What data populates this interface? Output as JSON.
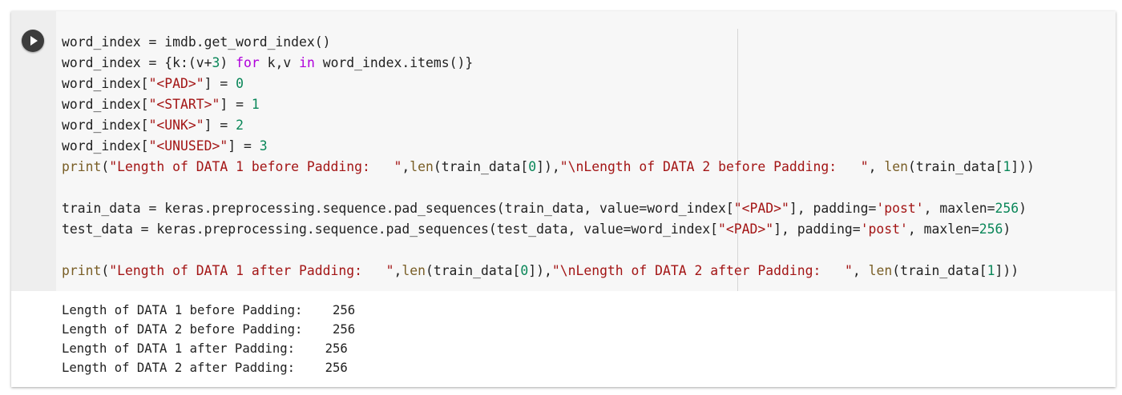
{
  "cell": {
    "run_button_icon": "play-icon",
    "code_lines": [
      [
        {
          "t": "word_index = imdb.get_word_index()",
          "c": "p"
        }
      ],
      [
        {
          "t": "word_index = {k:(v+",
          "c": "p"
        },
        {
          "t": "3",
          "c": "num"
        },
        {
          "t": ") ",
          "c": "p"
        },
        {
          "t": "for",
          "c": "kw"
        },
        {
          "t": " k,v ",
          "c": "p"
        },
        {
          "t": "in",
          "c": "kw"
        },
        {
          "t": " word_index.items()}",
          "c": "p"
        }
      ],
      [
        {
          "t": "word_index[",
          "c": "p"
        },
        {
          "t": "\"<PAD>\"",
          "c": "str"
        },
        {
          "t": "] = ",
          "c": "p"
        },
        {
          "t": "0",
          "c": "num"
        }
      ],
      [
        {
          "t": "word_index[",
          "c": "p"
        },
        {
          "t": "\"<START>\"",
          "c": "str"
        },
        {
          "t": "] = ",
          "c": "p"
        },
        {
          "t": "1",
          "c": "num"
        }
      ],
      [
        {
          "t": "word_index[",
          "c": "p"
        },
        {
          "t": "\"<UNK>\"",
          "c": "str"
        },
        {
          "t": "] = ",
          "c": "p"
        },
        {
          "t": "2",
          "c": "num"
        }
      ],
      [
        {
          "t": "word_index[",
          "c": "p"
        },
        {
          "t": "\"<UNUSED>\"",
          "c": "str"
        },
        {
          "t": "] = ",
          "c": "p"
        },
        {
          "t": "3",
          "c": "num"
        }
      ],
      [
        {
          "t": "print",
          "c": "fn"
        },
        {
          "t": "(",
          "c": "p"
        },
        {
          "t": "\"Length of DATA 1 before Padding:   \"",
          "c": "str"
        },
        {
          "t": ",",
          "c": "p"
        },
        {
          "t": "len",
          "c": "fn"
        },
        {
          "t": "(train_data[",
          "c": "p"
        },
        {
          "t": "0",
          "c": "num"
        },
        {
          "t": "]),",
          "c": "p"
        },
        {
          "t": "\"\\nLength of DATA 2 before Padding:   \"",
          "c": "str"
        },
        {
          "t": ", ",
          "c": "p"
        },
        {
          "t": "len",
          "c": "fn"
        },
        {
          "t": "(train_data[",
          "c": "p"
        },
        {
          "t": "1",
          "c": "num"
        },
        {
          "t": "]))",
          "c": "p"
        }
      ],
      [],
      [
        {
          "t": "train_data = keras.preprocessing.sequence.pad_sequences(train_data, value=word_index[",
          "c": "p"
        },
        {
          "t": "\"<PAD>\"",
          "c": "str"
        },
        {
          "t": "], padding=",
          "c": "p"
        },
        {
          "t": "'post'",
          "c": "str"
        },
        {
          "t": ", maxlen=",
          "c": "p"
        },
        {
          "t": "256",
          "c": "num"
        },
        {
          "t": ")",
          "c": "p"
        }
      ],
      [
        {
          "t": "test_data = keras.preprocessing.sequence.pad_sequences(test_data, value=word_index[",
          "c": "p"
        },
        {
          "t": "\"<PAD>\"",
          "c": "str"
        },
        {
          "t": "], padding=",
          "c": "p"
        },
        {
          "t": "'post'",
          "c": "str"
        },
        {
          "t": ", maxlen=",
          "c": "p"
        },
        {
          "t": "256",
          "c": "num"
        },
        {
          "t": ")",
          "c": "p"
        }
      ],
      [],
      [
        {
          "t": "print",
          "c": "fn"
        },
        {
          "t": "(",
          "c": "p"
        },
        {
          "t": "\"Length of DATA 1 after Padding:   \"",
          "c": "str"
        },
        {
          "t": ",",
          "c": "p"
        },
        {
          "t": "len",
          "c": "fn"
        },
        {
          "t": "(train_data[",
          "c": "p"
        },
        {
          "t": "0",
          "c": "num"
        },
        {
          "t": "]),",
          "c": "p"
        },
        {
          "t": "\"\\nLength of DATA 2 after Padding:   \"",
          "c": "str"
        },
        {
          "t": ", ",
          "c": "p"
        },
        {
          "t": "len",
          "c": "fn"
        },
        {
          "t": "(train_data[",
          "c": "p"
        },
        {
          "t": "1",
          "c": "num"
        },
        {
          "t": "]))",
          "c": "p"
        }
      ]
    ],
    "output_lines": [
      "Length of DATA 1 before Padding:    256",
      "Length of DATA 2 before Padding:    256",
      "Length of DATA 1 after Padding:    256",
      "Length of DATA 2 after Padding:    256"
    ]
  },
  "colors": {
    "keyword": "#af00db",
    "function": "#795e26",
    "string": "#a31515",
    "number": "#098658",
    "plain": "#222222",
    "code_background": "#f7f7f7",
    "run_button": "#3c3c3c"
  }
}
